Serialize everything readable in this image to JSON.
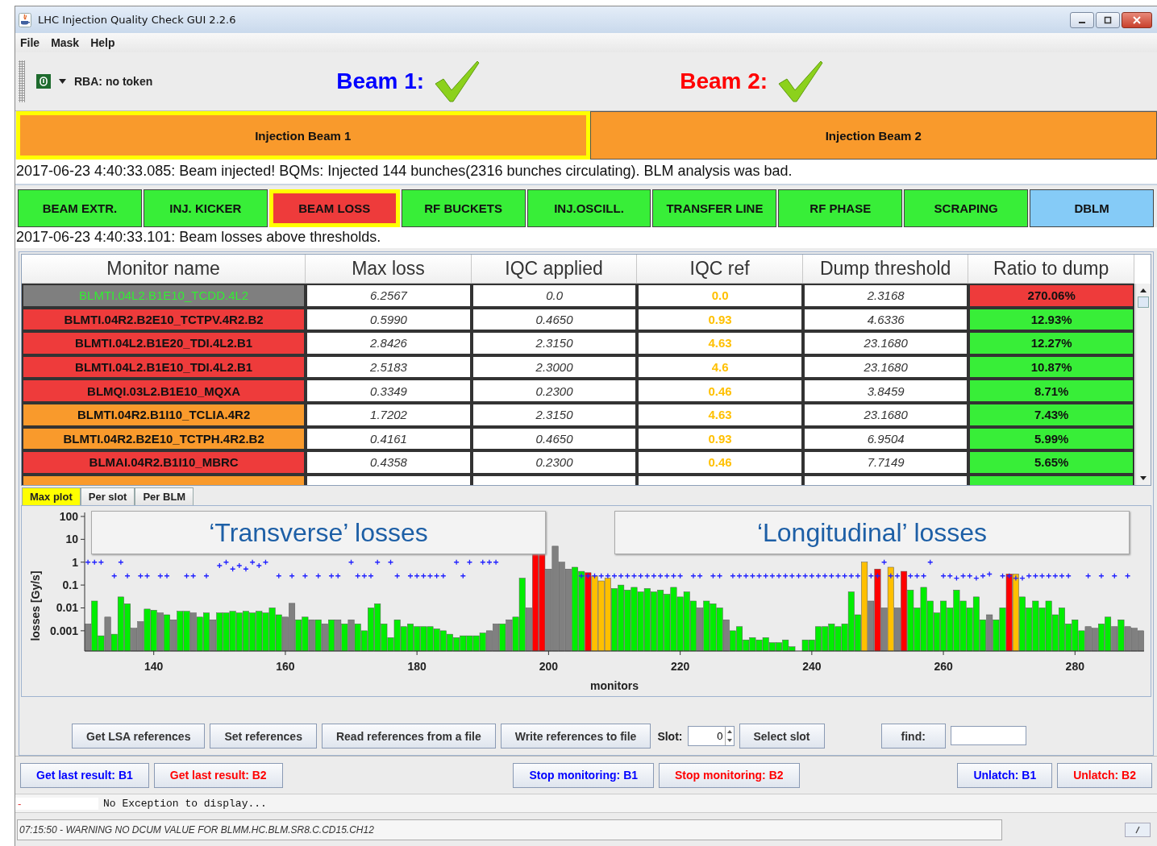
{
  "window": {
    "title": "LHC Injection Quality Check GUI 2.2.6"
  },
  "menu": [
    "File",
    "Mask",
    "Help"
  ],
  "toolbar": {
    "rba": "RBA: no token"
  },
  "beams": [
    {
      "label": "Beam 1:",
      "color": "#0000ff",
      "ok": true
    },
    {
      "label": "Beam 2:",
      "color": "#ff0000",
      "ok": true
    }
  ],
  "injection_tabs": [
    {
      "label": "Injection Beam 1",
      "selected": true
    },
    {
      "label": "Injection Beam 2",
      "selected": false
    }
  ],
  "injection_message": "2017-06-23 4:40:33.085: Beam injected! BQMs: Injected 144 bunches(2316 bunches circulating). BLM analysis was bad.",
  "checks": [
    {
      "label": "BEAM EXTR.",
      "color": "#38ee38",
      "selected": false
    },
    {
      "label": "INJ. KICKER",
      "color": "#38ee38",
      "selected": false
    },
    {
      "label": "BEAM LOSS",
      "color": "#ee3b3b",
      "selected": true
    },
    {
      "label": "RF BUCKETS",
      "color": "#38ee38",
      "selected": false
    },
    {
      "label": "INJ.OSCILL.",
      "color": "#38ee38",
      "selected": false
    },
    {
      "label": "TRANSFER LINE",
      "color": "#38ee38",
      "selected": false
    },
    {
      "label": "RF PHASE",
      "color": "#38ee38",
      "selected": false
    },
    {
      "label": "SCRAPING",
      "color": "#38ee38",
      "selected": false
    },
    {
      "label": "DBLM",
      "color": "#85cbf7",
      "selected": false
    }
  ],
  "check_message": "2017-06-23 4:40:33.101: Beam losses above thresholds.",
  "table": {
    "columns": [
      "Monitor name",
      "Max loss",
      "IQC applied",
      "IQC ref",
      "Dump threshold",
      "Ratio to dump"
    ],
    "rows": [
      {
        "monitor": "BLMTI.04L2.B1E10_TCDD.4L2",
        "color": "#7f7f7f",
        "masked": true,
        "max_loss": "6.2567",
        "iqc_applied": "0.0",
        "iqc_ref": "0.0",
        "dump_threshold": "2.3168",
        "ratio": {
          "text": "270.06%",
          "color": "#ee3b3b"
        }
      },
      {
        "monitor": "BLMTI.04R2.B2E10_TCTPV.4R2.B2",
        "color": "#ee3b3b",
        "masked": false,
        "max_loss": "0.5990",
        "iqc_applied": "0.4650",
        "iqc_ref": "0.93",
        "dump_threshold": "4.6336",
        "ratio": {
          "text": "12.93%",
          "color": "#38ee38"
        }
      },
      {
        "monitor": "BLMTI.04L2.B1E20_TDI.4L2.B1",
        "color": "#ee3b3b",
        "masked": false,
        "max_loss": "2.8426",
        "iqc_applied": "2.3150",
        "iqc_ref": "4.63",
        "dump_threshold": "23.1680",
        "ratio": {
          "text": "12.27%",
          "color": "#38ee38"
        }
      },
      {
        "monitor": "BLMTI.04L2.B1E10_TDI.4L2.B1",
        "color": "#ee3b3b",
        "masked": false,
        "max_loss": "2.5183",
        "iqc_applied": "2.3000",
        "iqc_ref": "4.6",
        "dump_threshold": "23.1680",
        "ratio": {
          "text": "10.87%",
          "color": "#38ee38"
        }
      },
      {
        "monitor": "BLMQI.03L2.B1E10_MQXA",
        "color": "#ee3b3b",
        "masked": false,
        "max_loss": "0.3349",
        "iqc_applied": "0.2300",
        "iqc_ref": "0.46",
        "dump_threshold": "3.8459",
        "ratio": {
          "text": "8.71%",
          "color": "#38ee38"
        }
      },
      {
        "monitor": "BLMTI.04R2.B1I10_TCLIA.4R2",
        "color": "#f99a2c",
        "masked": false,
        "max_loss": "1.7202",
        "iqc_applied": "2.3150",
        "iqc_ref": "4.63",
        "dump_threshold": "23.1680",
        "ratio": {
          "text": "7.43%",
          "color": "#38ee38"
        }
      },
      {
        "monitor": "BLMTI.04R2.B2E10_TCTPH.4R2.B2",
        "color": "#f99a2c",
        "masked": false,
        "max_loss": "0.4161",
        "iqc_applied": "0.4650",
        "iqc_ref": "0.93",
        "dump_threshold": "6.9504",
        "ratio": {
          "text": "5.99%",
          "color": "#38ee38"
        }
      },
      {
        "monitor": "BLMAI.04R2.B1I10_MBRC",
        "color": "#ee3b3b",
        "masked": false,
        "max_loss": "0.4358",
        "iqc_applied": "0.2300",
        "iqc_ref": "0.46",
        "dump_threshold": "7.7149",
        "ratio": {
          "text": "5.65%",
          "color": "#38ee38"
        }
      },
      {
        "color": "#f99a2c",
        "ratio": {
          "color": "#38ee38"
        }
      }
    ]
  },
  "plot": {
    "tabs": [
      {
        "label": "Max plot",
        "selected": true
      },
      {
        "label": "Per slot",
        "selected": false
      },
      {
        "label": "Per BLM",
        "selected": false
      }
    ],
    "xlabel": "monitors",
    "ylabel": "losses [Gy/s]",
    "y_ticks": [
      "100",
      "10",
      "1",
      "0.1",
      "0.01",
      "0.001"
    ],
    "x_ticks": [
      "140",
      "160",
      "180",
      "200",
      "220",
      "240",
      "260",
      "280"
    ],
    "annotations": [
      "‘Transverse’ losses",
      "‘Longitudinal’ losses"
    ]
  },
  "reference_buttons": [
    "Get LSA references",
    "Set references",
    "Read references from a file",
    "Write references to file"
  ],
  "slot": {
    "label": "Slot:",
    "value": "0"
  },
  "select_slot": "Select slot",
  "find": {
    "label": "find:"
  },
  "action_groups": [
    [
      {
        "label": "Get last result: B1",
        "color": "#0000ff"
      },
      {
        "label": "Get last result: B2",
        "color": "#ff0000"
      }
    ],
    [
      {
        "label": "Stop monitoring: B1",
        "color": "#0000ff"
      },
      {
        "label": "Stop monitoring: B2",
        "color": "#ff0000"
      }
    ],
    [
      {
        "label": "Unlatch: B1",
        "color": "#0000ff"
      },
      {
        "label": "Unlatch: B2",
        "color": "#ff0000"
      }
    ]
  ],
  "exception": {
    "marker": "-",
    "text": "No Exception to display..."
  },
  "status_message": "07:15:50 - WARNING NO DCUM VALUE FOR BLMM.HC.BLM.SR8.C.CD15.CH12"
}
